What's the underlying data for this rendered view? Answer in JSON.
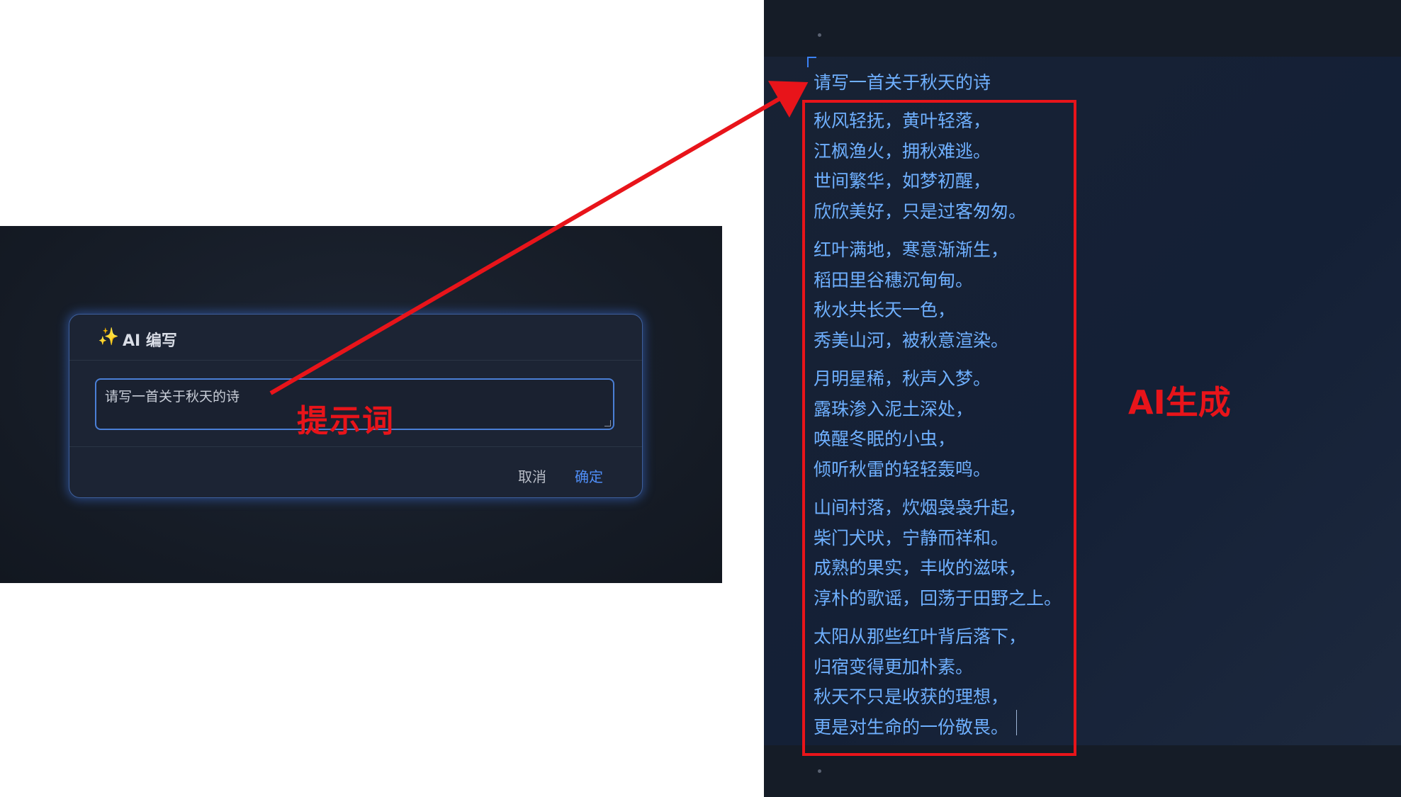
{
  "dialog": {
    "icon": "sparkle-icon",
    "title": "AI 编写",
    "prompt_value": "请写一首关于秋天的诗",
    "cancel_label": "取消",
    "ok_label": "确定"
  },
  "annotations": {
    "prompt_label": "提示词",
    "ai_label": "AI生成"
  },
  "editor": {
    "prompt_echo": "请写一首关于秋天的诗",
    "stanzas": [
      [
        "秋风轻抚，黄叶轻落，",
        "江枫渔火，拥秋难逃。",
        "世间繁华，如梦初醒，",
        "欣欣美好，只是过客匆匆。"
      ],
      [
        "红叶满地，寒意渐渐生，",
        "稻田里谷穗沉甸甸。",
        "秋水共长天一色，",
        "秀美山河，被秋意渲染。"
      ],
      [
        "月明星稀，秋声入梦。",
        "露珠渗入泥土深处，",
        "唤醒冬眠的小虫，",
        "倾听秋雷的轻轻轰鸣。"
      ],
      [
        "山间村落，炊烟袅袅升起，",
        "柴门犬吠，宁静而祥和。",
        "成熟的果实，丰收的滋味，",
        "淳朴的歌谣，回荡于田野之上。"
      ],
      [
        "太阳从那些红叶背后落下，",
        "归宿变得更加朴素。",
        "秋天不只是收获的理想，",
        "更是对生命的一份敬畏。"
      ]
    ]
  },
  "colors": {
    "annotation_red": "#e8141a",
    "poem_text": "#6fb0ff",
    "accent_blue": "#4f8ef7"
  }
}
